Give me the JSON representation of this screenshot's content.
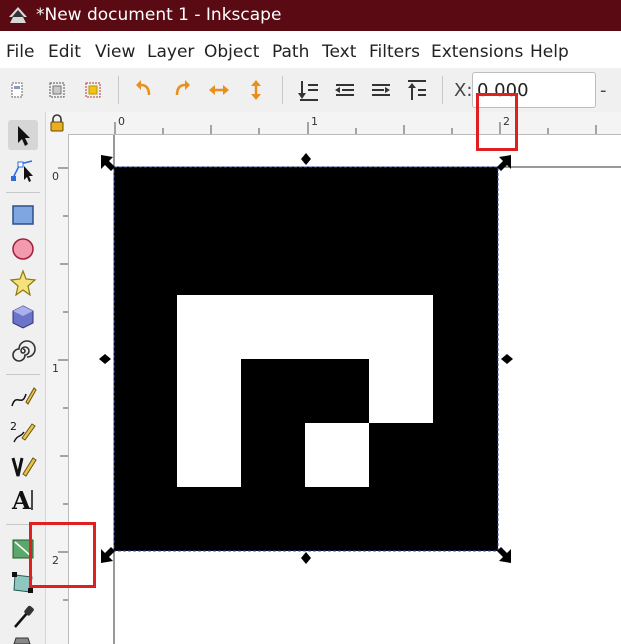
{
  "window": {
    "title": "*New document 1 - Inkscape"
  },
  "menu": [
    "File",
    "Edit",
    "View",
    "Layer",
    "Object",
    "Path",
    "Text",
    "Filters",
    "Extensions",
    "Help"
  ],
  "toolbar": {
    "x_label": "X:",
    "x_value": "0.000",
    "minus": "-"
  },
  "ruler": {
    "h_labels": [
      "0",
      "1",
      "2"
    ],
    "v_labels": [
      "0",
      "1",
      "2"
    ]
  },
  "colors": {
    "titlebar": "#5a0a13",
    "accent_orange": "#e8901e",
    "annotation_red": "#e02020",
    "shape_fill": "#000000"
  }
}
